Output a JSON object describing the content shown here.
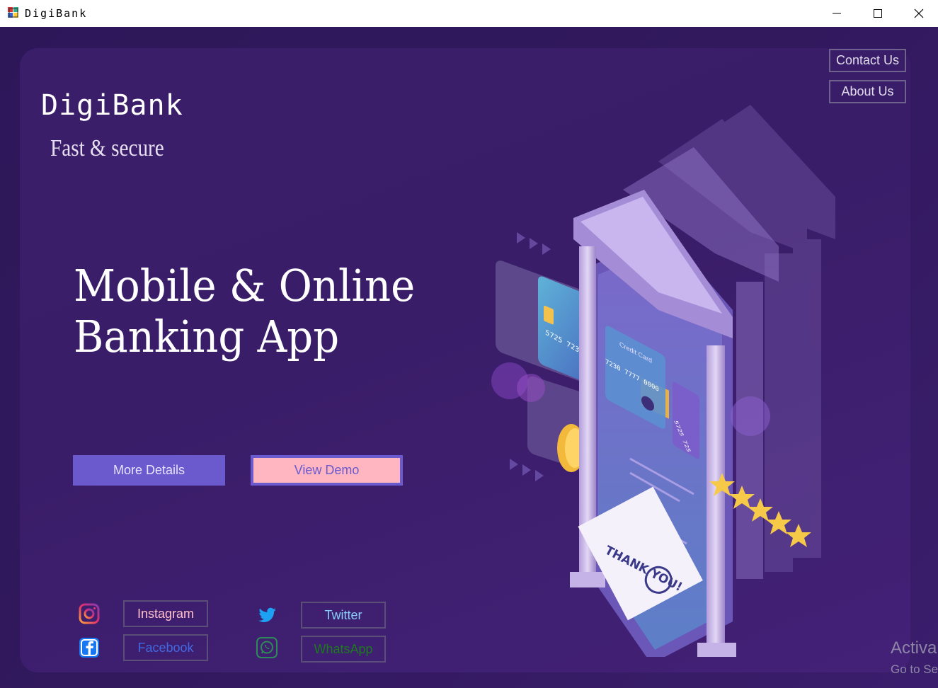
{
  "window": {
    "title": "DigiBank"
  },
  "header": {
    "brand": "DigiBank",
    "tagline": "Fast & secure"
  },
  "nav": {
    "contact_label": "Contact Us",
    "about_label": "About Us"
  },
  "hero": {
    "headline_line1": "Mobile & Online",
    "headline_line2": "Banking App"
  },
  "actions": {
    "more_details_label": "More Details",
    "view_demo_label": "View Demo"
  },
  "social": {
    "instagram_label": "Instagram",
    "facebook_label": "Facebook",
    "twitter_label": "Twitter",
    "whatsapp_label": "WhatsApp"
  },
  "illustration": {
    "receipt_text": "THANK YOU!",
    "card_number_1": "5725 723",
    "card_number_2": "7230 7777 0000",
    "card_number_3": "5725 725",
    "card_caption": "Credit Card",
    "rating_stars": 5
  },
  "watermark": {
    "line1": "Activa",
    "line2": "Go to Se"
  },
  "colors": {
    "background": "#3a1d69",
    "accent": "#6a5acd",
    "demo_fill": "#ffb6c1",
    "facebook_text": "#4169e1",
    "whatsapp_text": "#1e7a1e",
    "instagram_text": "#ffc0cb",
    "twitter_text": "#87cefa"
  }
}
